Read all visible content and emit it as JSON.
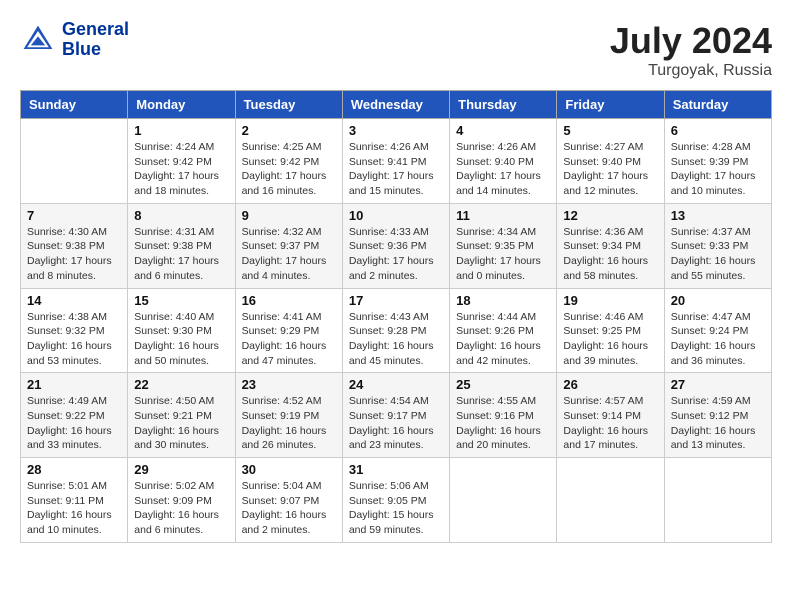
{
  "header": {
    "logo_line1": "General",
    "logo_line2": "Blue",
    "title": "July 2024",
    "location": "Turgoyak, Russia"
  },
  "weekdays": [
    "Sunday",
    "Monday",
    "Tuesday",
    "Wednesday",
    "Thursday",
    "Friday",
    "Saturday"
  ],
  "weeks": [
    [
      {
        "day": "",
        "info": ""
      },
      {
        "day": "1",
        "info": "Sunrise: 4:24 AM\nSunset: 9:42 PM\nDaylight: 17 hours\nand 18 minutes."
      },
      {
        "day": "2",
        "info": "Sunrise: 4:25 AM\nSunset: 9:42 PM\nDaylight: 17 hours\nand 16 minutes."
      },
      {
        "day": "3",
        "info": "Sunrise: 4:26 AM\nSunset: 9:41 PM\nDaylight: 17 hours\nand 15 minutes."
      },
      {
        "day": "4",
        "info": "Sunrise: 4:26 AM\nSunset: 9:40 PM\nDaylight: 17 hours\nand 14 minutes."
      },
      {
        "day": "5",
        "info": "Sunrise: 4:27 AM\nSunset: 9:40 PM\nDaylight: 17 hours\nand 12 minutes."
      },
      {
        "day": "6",
        "info": "Sunrise: 4:28 AM\nSunset: 9:39 PM\nDaylight: 17 hours\nand 10 minutes."
      }
    ],
    [
      {
        "day": "7",
        "info": "Sunrise: 4:30 AM\nSunset: 9:38 PM\nDaylight: 17 hours\nand 8 minutes."
      },
      {
        "day": "8",
        "info": "Sunrise: 4:31 AM\nSunset: 9:38 PM\nDaylight: 17 hours\nand 6 minutes."
      },
      {
        "day": "9",
        "info": "Sunrise: 4:32 AM\nSunset: 9:37 PM\nDaylight: 17 hours\nand 4 minutes."
      },
      {
        "day": "10",
        "info": "Sunrise: 4:33 AM\nSunset: 9:36 PM\nDaylight: 17 hours\nand 2 minutes."
      },
      {
        "day": "11",
        "info": "Sunrise: 4:34 AM\nSunset: 9:35 PM\nDaylight: 17 hours\nand 0 minutes."
      },
      {
        "day": "12",
        "info": "Sunrise: 4:36 AM\nSunset: 9:34 PM\nDaylight: 16 hours\nand 58 minutes."
      },
      {
        "day": "13",
        "info": "Sunrise: 4:37 AM\nSunset: 9:33 PM\nDaylight: 16 hours\nand 55 minutes."
      }
    ],
    [
      {
        "day": "14",
        "info": "Sunrise: 4:38 AM\nSunset: 9:32 PM\nDaylight: 16 hours\nand 53 minutes."
      },
      {
        "day": "15",
        "info": "Sunrise: 4:40 AM\nSunset: 9:30 PM\nDaylight: 16 hours\nand 50 minutes."
      },
      {
        "day": "16",
        "info": "Sunrise: 4:41 AM\nSunset: 9:29 PM\nDaylight: 16 hours\nand 47 minutes."
      },
      {
        "day": "17",
        "info": "Sunrise: 4:43 AM\nSunset: 9:28 PM\nDaylight: 16 hours\nand 45 minutes."
      },
      {
        "day": "18",
        "info": "Sunrise: 4:44 AM\nSunset: 9:26 PM\nDaylight: 16 hours\nand 42 minutes."
      },
      {
        "day": "19",
        "info": "Sunrise: 4:46 AM\nSunset: 9:25 PM\nDaylight: 16 hours\nand 39 minutes."
      },
      {
        "day": "20",
        "info": "Sunrise: 4:47 AM\nSunset: 9:24 PM\nDaylight: 16 hours\nand 36 minutes."
      }
    ],
    [
      {
        "day": "21",
        "info": "Sunrise: 4:49 AM\nSunset: 9:22 PM\nDaylight: 16 hours\nand 33 minutes."
      },
      {
        "day": "22",
        "info": "Sunrise: 4:50 AM\nSunset: 9:21 PM\nDaylight: 16 hours\nand 30 minutes."
      },
      {
        "day": "23",
        "info": "Sunrise: 4:52 AM\nSunset: 9:19 PM\nDaylight: 16 hours\nand 26 minutes."
      },
      {
        "day": "24",
        "info": "Sunrise: 4:54 AM\nSunset: 9:17 PM\nDaylight: 16 hours\nand 23 minutes."
      },
      {
        "day": "25",
        "info": "Sunrise: 4:55 AM\nSunset: 9:16 PM\nDaylight: 16 hours\nand 20 minutes."
      },
      {
        "day": "26",
        "info": "Sunrise: 4:57 AM\nSunset: 9:14 PM\nDaylight: 16 hours\nand 17 minutes."
      },
      {
        "day": "27",
        "info": "Sunrise: 4:59 AM\nSunset: 9:12 PM\nDaylight: 16 hours\nand 13 minutes."
      }
    ],
    [
      {
        "day": "28",
        "info": "Sunrise: 5:01 AM\nSunset: 9:11 PM\nDaylight: 16 hours\nand 10 minutes."
      },
      {
        "day": "29",
        "info": "Sunrise: 5:02 AM\nSunset: 9:09 PM\nDaylight: 16 hours\nand 6 minutes."
      },
      {
        "day": "30",
        "info": "Sunrise: 5:04 AM\nSunset: 9:07 PM\nDaylight: 16 hours\nand 2 minutes."
      },
      {
        "day": "31",
        "info": "Sunrise: 5:06 AM\nSunset: 9:05 PM\nDaylight: 15 hours\nand 59 minutes."
      },
      {
        "day": "",
        "info": ""
      },
      {
        "day": "",
        "info": ""
      },
      {
        "day": "",
        "info": ""
      }
    ]
  ]
}
